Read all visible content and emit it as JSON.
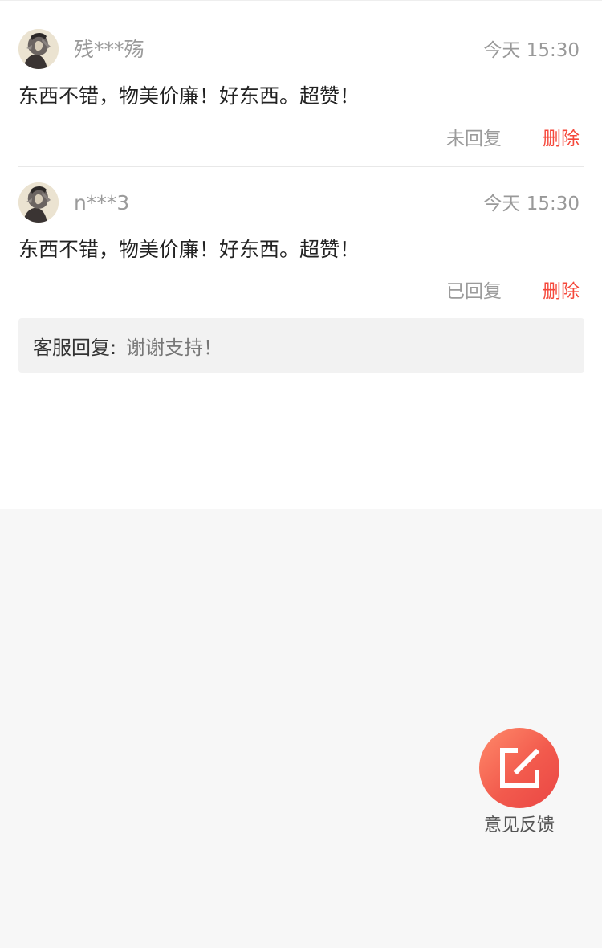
{
  "comments": [
    {
      "username": "残***殇",
      "time": "今天  15:30",
      "content": "东西不错，物美价廉！好东西。超赞！",
      "reply_status": "未回复",
      "delete_label": "删除"
    },
    {
      "username": "n***3",
      "time": "今天  15:30",
      "content": "东西不错，物美价廉！好东西。超赞！",
      "reply_status": "已回复",
      "delete_label": "删除",
      "service_reply": {
        "label": "客服回复:",
        "text": "谢谢支持！"
      }
    }
  ],
  "feedback": {
    "label": "意见反馈",
    "icon": "edit-icon"
  },
  "colors": {
    "accent": "#f5483b",
    "background": "#f7f7f7",
    "muted_text": "#9b9b9b"
  }
}
